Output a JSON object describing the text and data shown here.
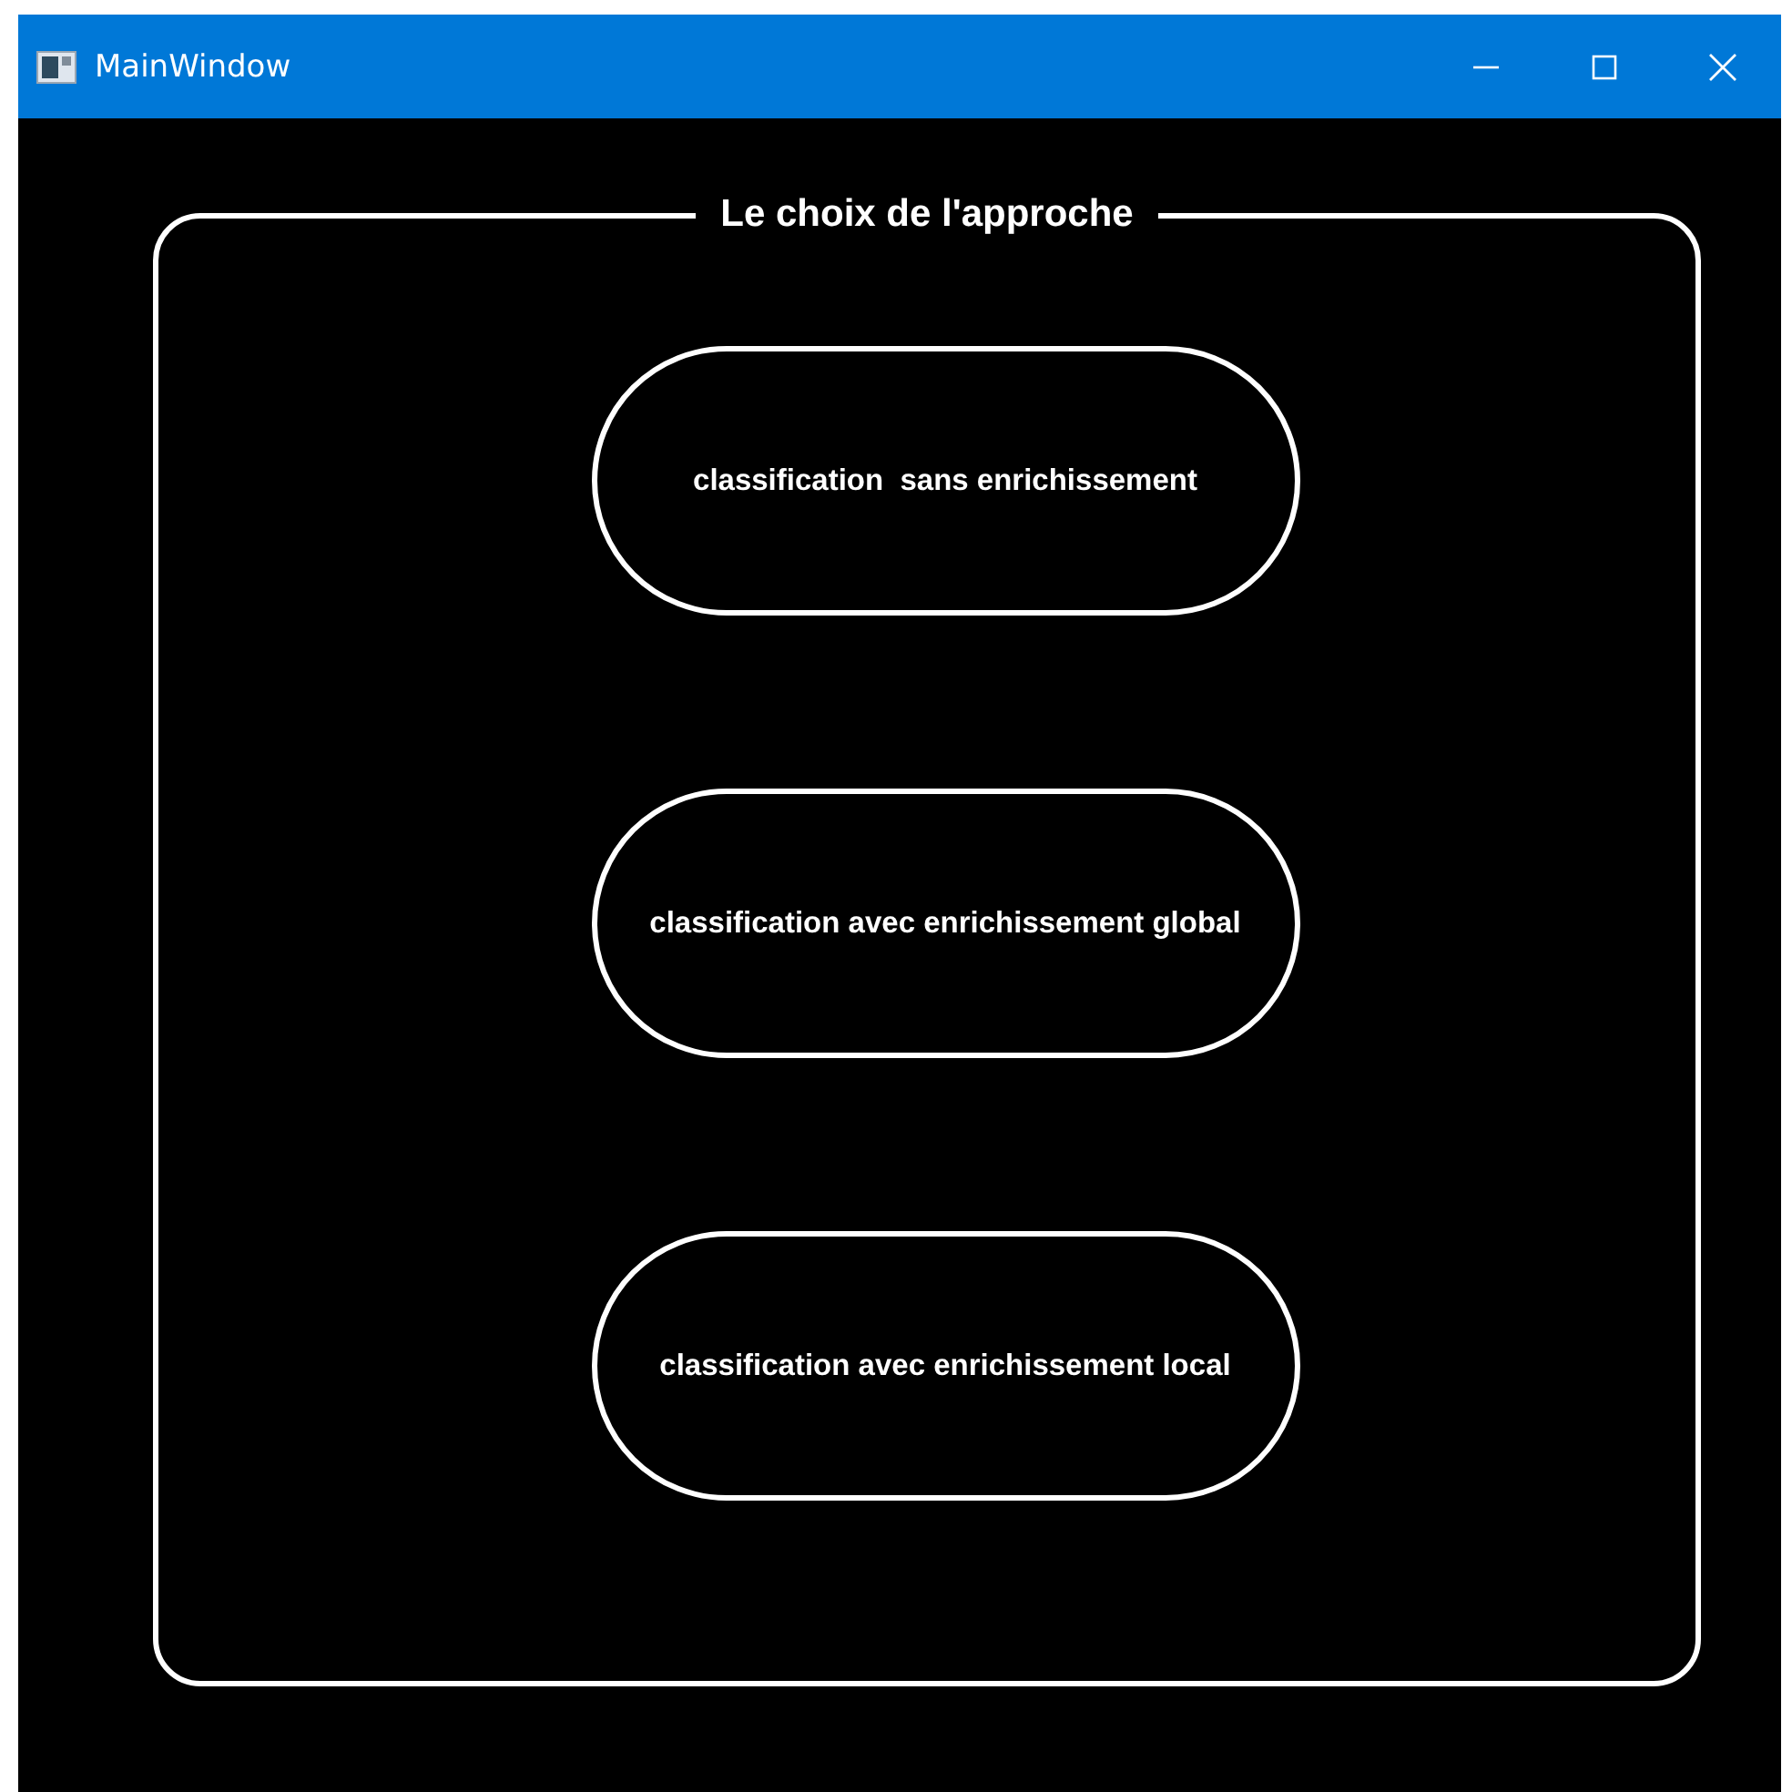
{
  "window": {
    "title": "MainWindow"
  },
  "group": {
    "title": "Le choix de l'approche",
    "buttons": [
      {
        "label": "classification  sans enrichissement"
      },
      {
        "label": "classification avec enrichissement global"
      },
      {
        "label": "classification avec enrichissement local"
      }
    ]
  }
}
